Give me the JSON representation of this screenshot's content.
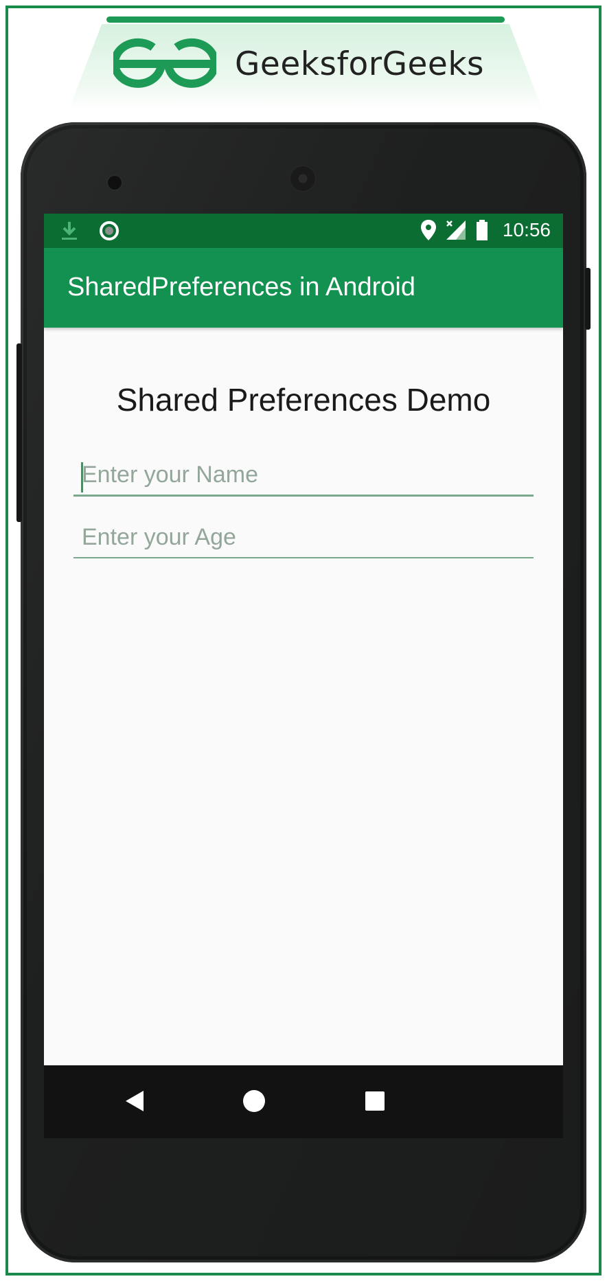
{
  "brand": {
    "name": "GeeksforGeeks",
    "logo_icon": "gfg-logo-icon",
    "accent_color": "#1d9a55"
  },
  "status_bar": {
    "time": "10:56",
    "icons": [
      "download-icon",
      "record-icon",
      "location-icon",
      "signal-icon",
      "battery-icon"
    ],
    "color": "#0b6d32"
  },
  "app_bar": {
    "title": "SharedPreferences in Android",
    "color": "#139150"
  },
  "main": {
    "heading": "Shared Preferences Demo",
    "name_field": {
      "value": "",
      "placeholder": "Enter your Name"
    },
    "age_field": {
      "value": "",
      "placeholder": "Enter your Age"
    }
  },
  "nav_bar": {
    "buttons": [
      "back-icon",
      "home-icon",
      "recents-icon"
    ]
  }
}
